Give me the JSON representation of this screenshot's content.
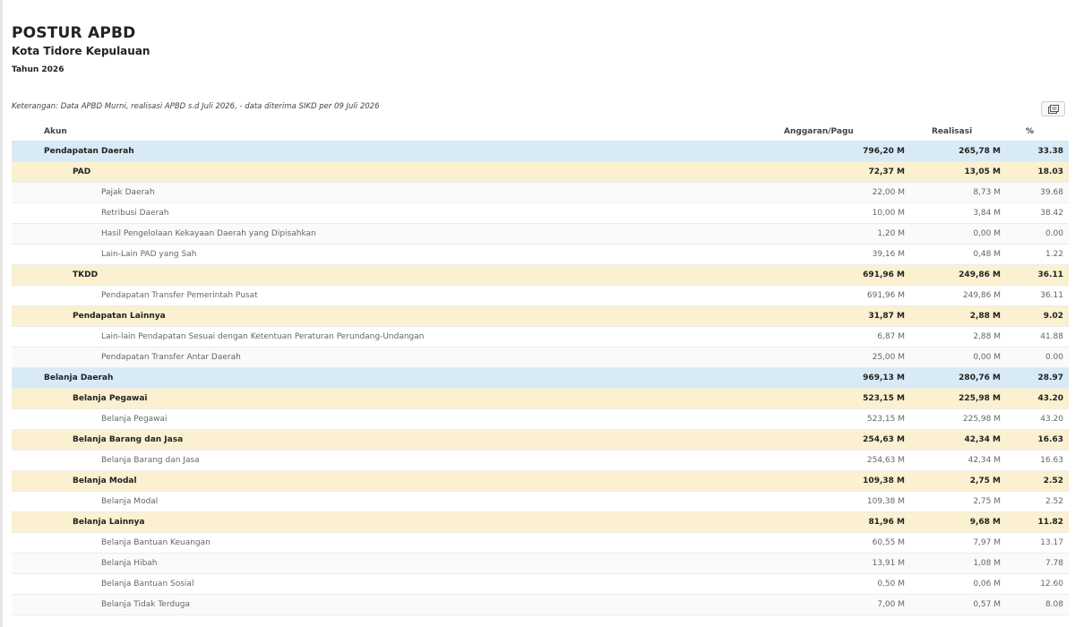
{
  "header": {
    "title": "POSTUR APBD",
    "subtitle": "Kota Tidore Kepulauan",
    "year": "Tahun 2026",
    "note": "Keterangan: Data APBD Murni, realisasi APBD s.d Juli 2026, - data diterima SIKD per 09 Juli 2026"
  },
  "toolbar": {
    "export_icon": "export-icon"
  },
  "columns": {
    "akun": "Akun",
    "anggaran": "Anggaran/Pagu",
    "realisasi": "Realisasi",
    "persen": "%"
  },
  "rows": [
    {
      "level": 0,
      "akun": "Pendapatan Daerah",
      "anggaran": "796,20 M",
      "realisasi": "265,78 M",
      "persen": "33.38"
    },
    {
      "level": 1,
      "akun": "PAD",
      "anggaran": "72,37 M",
      "realisasi": "13,05 M",
      "persen": "18.03"
    },
    {
      "level": 2,
      "akun": "Pajak Daerah",
      "anggaran": "22,00 M",
      "realisasi": "8,73 M",
      "persen": "39.68"
    },
    {
      "level": 2,
      "akun": "Retribusi Daerah",
      "anggaran": "10,00 M",
      "realisasi": "3,84 M",
      "persen": "38.42"
    },
    {
      "level": 2,
      "akun": "Hasil Pengelolaan Kekayaan Daerah yang Dipisahkan",
      "anggaran": "1,20 M",
      "realisasi": "0,00 M",
      "persen": "0.00"
    },
    {
      "level": 2,
      "akun": "Lain-Lain PAD yang Sah",
      "anggaran": "39,16 M",
      "realisasi": "0,48 M",
      "persen": "1.22"
    },
    {
      "level": 1,
      "akun": "TKDD",
      "anggaran": "691,96 M",
      "realisasi": "249,86 M",
      "persen": "36.11"
    },
    {
      "level": 2,
      "akun": "Pendapatan Transfer Pemerintah Pusat",
      "anggaran": "691,96 M",
      "realisasi": "249,86 M",
      "persen": "36.11"
    },
    {
      "level": 1,
      "akun": "Pendapatan Lainnya",
      "anggaran": "31,87 M",
      "realisasi": "2,88 M",
      "persen": "9.02"
    },
    {
      "level": 2,
      "akun": "Lain-lain Pendapatan Sesuai dengan Ketentuan Peraturan Perundang-Undangan",
      "anggaran": "6,87 M",
      "realisasi": "2,88 M",
      "persen": "41.88"
    },
    {
      "level": 2,
      "akun": "Pendapatan Transfer Antar Daerah",
      "anggaran": "25,00 M",
      "realisasi": "0,00 M",
      "persen": "0.00"
    },
    {
      "level": 0,
      "akun": "Belanja Daerah",
      "anggaran": "969,13 M",
      "realisasi": "280,76 M",
      "persen": "28.97"
    },
    {
      "level": 1,
      "akun": "Belanja Pegawai",
      "anggaran": "523,15 M",
      "realisasi": "225,98 M",
      "persen": "43.20"
    },
    {
      "level": 2,
      "akun": "Belanja Pegawai",
      "anggaran": "523,15 M",
      "realisasi": "225,98 M",
      "persen": "43.20"
    },
    {
      "level": 1,
      "akun": "Belanja Barang dan Jasa",
      "anggaran": "254,63 M",
      "realisasi": "42,34 M",
      "persen": "16.63"
    },
    {
      "level": 2,
      "akun": "Belanja Barang dan Jasa",
      "anggaran": "254,63 M",
      "realisasi": "42,34 M",
      "persen": "16.63"
    },
    {
      "level": 1,
      "akun": "Belanja Modal",
      "anggaran": "109,38 M",
      "realisasi": "2,75 M",
      "persen": "2.52"
    },
    {
      "level": 2,
      "akun": "Belanja Modal",
      "anggaran": "109,38 M",
      "realisasi": "2,75 M",
      "persen": "2.52"
    },
    {
      "level": 1,
      "akun": "Belanja Lainnya",
      "anggaran": "81,96 M",
      "realisasi": "9,68 M",
      "persen": "11.82"
    },
    {
      "level": 2,
      "akun": "Belanja Bantuan Keuangan",
      "anggaran": "60,55 M",
      "realisasi": "7,97 M",
      "persen": "13.17"
    },
    {
      "level": 2,
      "akun": "Belanja Hibah",
      "anggaran": "13,91 M",
      "realisasi": "1,08 M",
      "persen": "7.78"
    },
    {
      "level": 2,
      "akun": "Belanja Bantuan Sosial",
      "anggaran": "0,50 M",
      "realisasi": "0,06 M",
      "persen": "12.60"
    },
    {
      "level": 2,
      "akun": "Belanja Tidak Terduga",
      "anggaran": "7,00 M",
      "realisasi": "0,57 M",
      "persen": "8.08"
    }
  ]
}
